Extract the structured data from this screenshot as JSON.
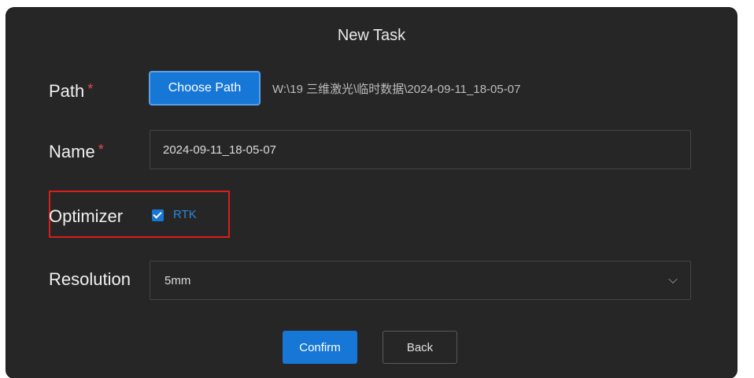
{
  "dialog": {
    "title": "New Task"
  },
  "path": {
    "label": "Path",
    "required_mark": "*",
    "button_label": "Choose Path",
    "value": "W:\\19 三维激光\\临时数据\\2024-09-11_18-05-07"
  },
  "name": {
    "label": "Name",
    "required_mark": "*",
    "value": "2024-09-11_18-05-07"
  },
  "optimizer": {
    "label": "Optimizer",
    "option_label": "RTK",
    "checked": true
  },
  "resolution": {
    "label": "Resolution",
    "selected": "5mm"
  },
  "actions": {
    "confirm_label": "Confirm",
    "back_label": "Back"
  },
  "colors": {
    "dialog_background": "#262626",
    "accent": "#1677d6",
    "required": "#e5484d",
    "highlight_box": "#d91e1e"
  },
  "icons": {
    "select_arrow": "chevron-down-icon",
    "checkbox": "checkmark-icon"
  }
}
